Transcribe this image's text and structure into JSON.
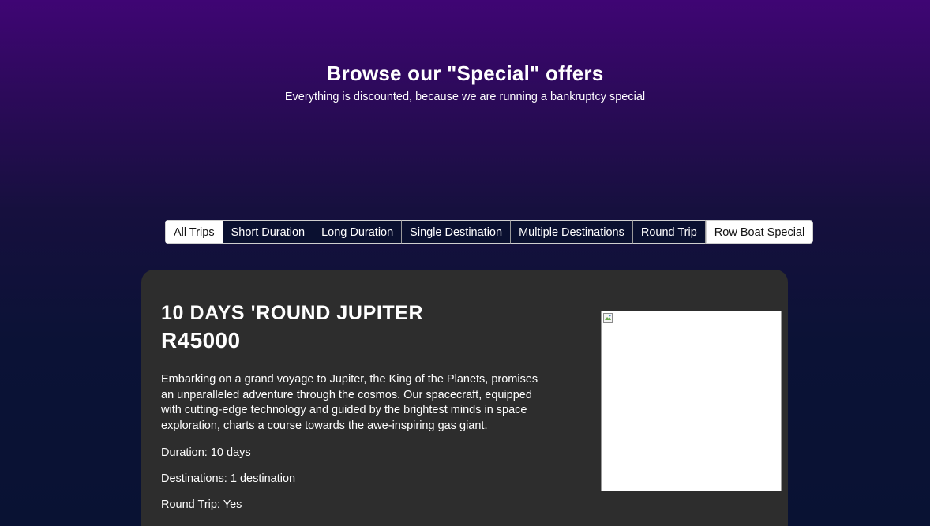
{
  "hero": {
    "title": "Browse our \"Special\" offers",
    "subtitle": "Everything is discounted, because we are running a bankruptcy special"
  },
  "filters": [
    {
      "label": "All Trips",
      "style": "light"
    },
    {
      "label": "Short Duration",
      "style": "dark"
    },
    {
      "label": "Long Duration",
      "style": "dark"
    },
    {
      "label": "Single Destination",
      "style": "dark"
    },
    {
      "label": "Multiple Destinations",
      "style": "dark"
    },
    {
      "label": "Round Trip",
      "style": "dark"
    },
    {
      "label": "Row Boat Special",
      "style": "light"
    }
  ],
  "trip": {
    "title": "10 Days 'Round Jupiter",
    "price": "R45000",
    "description": "Embarking on a grand voyage to Jupiter, the King of the Planets, promises an unparalleled adventure through the cosmos. Our spacecraft, equipped with cutting-edge technology and guided by the brightest minds in space exploration, charts a course towards the awe-inspiring gas giant.",
    "duration": "Duration: 10 days",
    "destinations": "Destinations: 1 destination",
    "round_trip": "Round Trip: Yes",
    "image_icon": "broken-image-icon"
  },
  "colors": {
    "card_background": "#2d2d2d",
    "page_gradient_top": "#3f0574",
    "page_gradient_bottom": "#091233",
    "filter_dark": "#0a1030",
    "filter_light": "#ffffff"
  }
}
